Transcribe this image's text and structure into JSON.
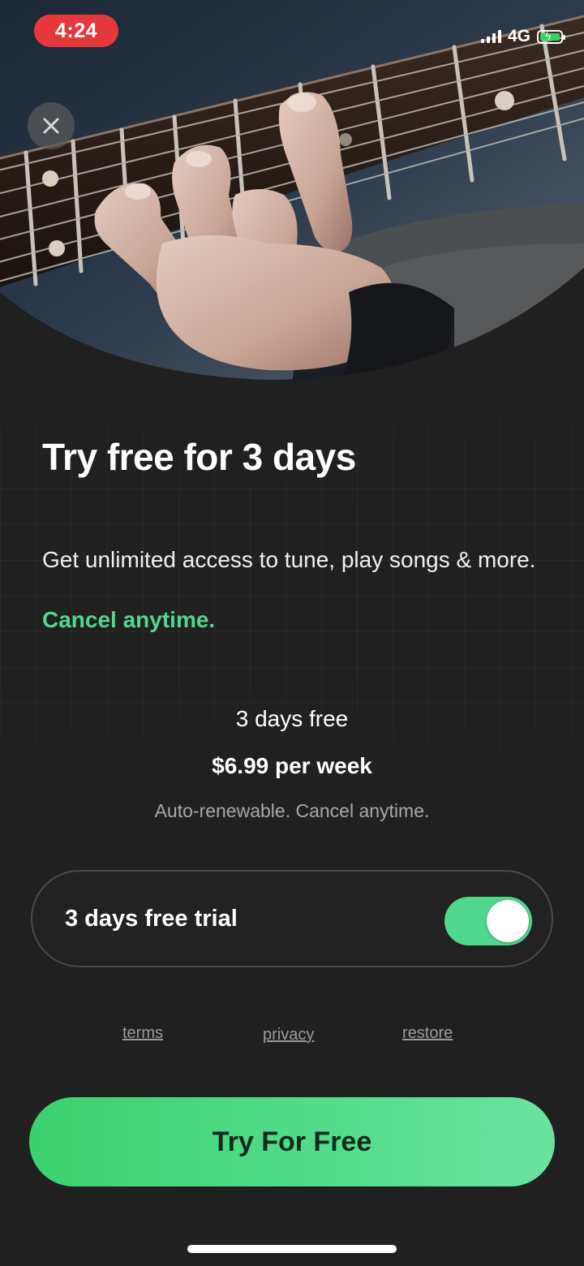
{
  "status_bar": {
    "time": "4:24",
    "network": "4G"
  },
  "header": {
    "close_icon": "close-icon"
  },
  "hero": {
    "image": "guitar-fretboard-hand-photo"
  },
  "content": {
    "title": "Try free for 3 days",
    "subtitle": "Get unlimited access to tune, play songs & more.",
    "cancel_text": "Cancel anytime."
  },
  "pricing": {
    "trial_days": "3 days free",
    "price": "$6.99 per week",
    "note": "Auto-renewable. Cancel anytime."
  },
  "trial_toggle": {
    "label": "3 days free trial",
    "enabled": true
  },
  "links": {
    "terms": "terms",
    "privacy": "privacy",
    "restore": "restore"
  },
  "cta": {
    "label": "Try For Free"
  },
  "colors": {
    "accent": "#4fd88e",
    "background": "#202020",
    "time_pill": "#e5383b"
  }
}
